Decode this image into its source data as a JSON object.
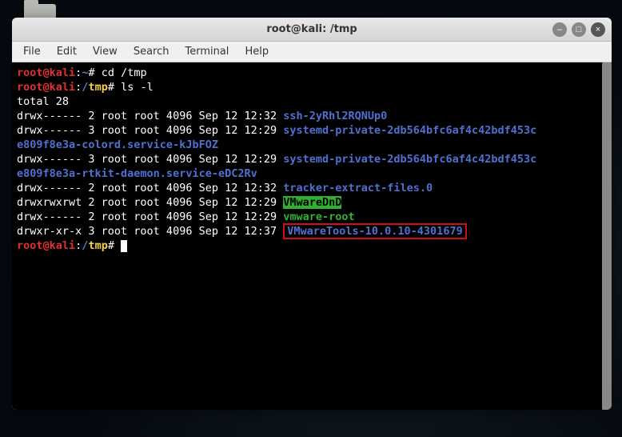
{
  "window": {
    "title": "root@kali: /tmp"
  },
  "menu": {
    "file": "File",
    "edit": "Edit",
    "view": "View",
    "search": "Search",
    "terminal": "Terminal",
    "help": "Help"
  },
  "terminal": {
    "user": "root@kali",
    "sep": ":",
    "home_path": "~",
    "tmp_path": "/tmp",
    "hash": "#",
    "cmd1": " cd /tmp",
    "cmd2": " ls -l",
    "total": "total 28",
    "entries": [
      {
        "perm": "drwx------ 2 root root 4096 Sep 12 12:32 ",
        "name": "ssh-2yRhl2RQNUp0",
        "style": "blue"
      },
      {
        "perm": "drwx------ 3 root root 4096 Sep 12 12:29 ",
        "name": "systemd-private-2db564bfc6af4c42bdf453c",
        "cont": "e809f8e3a-colord.service-kJbFOZ",
        "style": "blue"
      },
      {
        "perm": "drwx------ 3 root root 4096 Sep 12 12:29 ",
        "name": "systemd-private-2db564bfc6af4c42bdf453c",
        "cont": "e809f8e3a-rtkit-daemon.service-eDC2Rv",
        "style": "blue"
      },
      {
        "perm": "drwx------ 2 root root 4096 Sep 12 12:32 ",
        "name": "tracker-extract-files.0",
        "style": "blue"
      },
      {
        "perm": "drwxrwxrwt 2 root root 4096 Sep 12 12:29 ",
        "name": "VMwareDnD",
        "style": "hl"
      },
      {
        "perm": "drwx------ 2 root root 4096 Sep 12 12:29 ",
        "name": "vmware-root",
        "style": "green"
      },
      {
        "perm": "drwxr-xr-x 3 root root 4096 Sep 12 12:37 ",
        "name": "VMwareTools-10.0.10-4301679",
        "style": "blue",
        "boxed": true
      }
    ]
  }
}
